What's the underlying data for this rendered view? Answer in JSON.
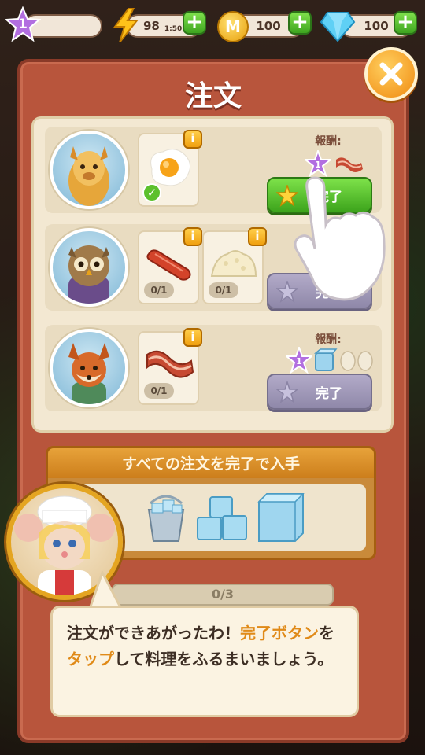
{
  "hud": {
    "level": "1",
    "energy": {
      "value": "98",
      "timer": "1:50"
    },
    "coins": "100",
    "gems": "100"
  },
  "panel": {
    "title": "注文"
  },
  "orders": [
    {
      "customer": "alpaca",
      "items": [
        {
          "name": "fried-egg",
          "done": true
        }
      ],
      "reward_label": "報酬:",
      "reward_icons": [
        "star-xp-icon",
        "bacon-icon"
      ],
      "button_label": "完了",
      "button_state": "active"
    },
    {
      "customer": "owl",
      "items": [
        {
          "name": "sausage",
          "count": "0/1"
        },
        {
          "name": "rice",
          "count": "0/1"
        }
      ],
      "reward_label": "報酬:",
      "reward_icons": [
        "star-xp-icon"
      ],
      "button_label": "完了",
      "button_state": "disabled"
    },
    {
      "customer": "fox",
      "items": [
        {
          "name": "bacon",
          "count": "0/1"
        }
      ],
      "reward_label": "報酬:",
      "reward_icons": [
        "star-xp-icon",
        "ice-cube-icon",
        "egg-icon",
        "egg-icon"
      ],
      "button_label": "完了",
      "button_state": "disabled"
    }
  ],
  "bonus": {
    "title": "すべての注文を完了で入手",
    "items": [
      "ice-bucket-icon",
      "ice-cubes-icon",
      "big-ice-block-icon"
    ]
  },
  "progress": "0/3",
  "dialog": {
    "part1": "注文ができあがったわ！",
    "highlight1": "完了ボタン",
    "part2": "を",
    "highlight2": "タップ",
    "part3": "して料理をふるまいましょう。"
  },
  "colors": {
    "panel": "#b8553c",
    "green_button": "#3da41c",
    "disabled_button": "#8f88a9",
    "highlight_text": "#e08a18"
  }
}
